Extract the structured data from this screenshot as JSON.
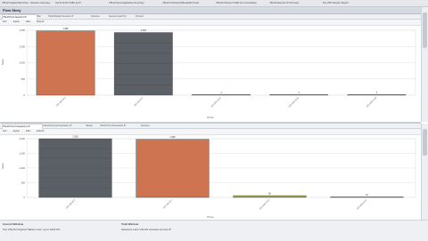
{
  "top_tabs": [
    {
      "label": "VSLAN Capital Reef Flow - Sessions Summary"
    },
    {
      "label": "Top-N VLAN Traffic by IP"
    },
    {
      "label": "VSLAN Host Application Summary"
    },
    {
      "label": "VSLAN Outbound Bandwidth Trend"
    },
    {
      "label": "VSLAN Inbound Traffic by Conversation"
    },
    {
      "label": "VSLAN Remote IP Summary"
    },
    {
      "label": "Top VPN Session Report"
    }
  ],
  "window": {
    "title": "Flow Story"
  },
  "upper_panel": {
    "tabs": [
      "VSLAN Host Sessions IP",
      "Bar",
      "Table/Stacked Sessions IP",
      "Sessions",
      "Sessions (last 5m)",
      "Protocol"
    ],
    "toolbar": [
      "Sort",
      "Export",
      "Filter",
      "Refresh"
    ],
    "x_title": "Proto",
    "y_title": "Sess"
  },
  "lower_panel": {
    "tabs": [
      "VSLAN Host Transactions IP",
      "VSLAN Remote Destination IP",
      "Tabular",
      "VSLAN Host Destination IP",
      "Sessions"
    ],
    "toolbar": [
      "Sort",
      "Export",
      "Filter",
      "Refresh"
    ],
    "x_title": "Proto",
    "y_title": "Sess"
  },
  "status": {
    "left_label": "Current Window",
    "left_text": "Top VSLAN Original Talkers  max: up to 1023 IPs",
    "right_label": "Total Window",
    "right_text": "Selected: Host VSLAN sessions across IP"
  },
  "colors": {
    "orange": "#cf7450",
    "gray": "#5b6066",
    "background": "#ffffff"
  },
  "chart_data": [
    {
      "type": "bar",
      "categories": [
        "192.168.10.5",
        "192.168.10.7",
        "192.168.10.12",
        "192.168.10.21",
        "192.168.10.33"
      ],
      "values": [
        1980,
        1930,
        3,
        4,
        3
      ],
      "value_labels": [
        "1,980",
        "1,930",
        "3",
        "4",
        "3"
      ],
      "bar_colors": [
        "#cf7450",
        "#5b6066",
        "#7a6f66",
        "#7a6f66",
        "#7a6f66"
      ],
      "yticks": [
        "0",
        "500",
        "1,000",
        "1,500",
        "2,000"
      ],
      "ylim": [
        0,
        2000
      ],
      "grid": true
    },
    {
      "type": "bar",
      "categories": [
        "192.168.10.5",
        "192.168.10.7",
        "192.168.10.12",
        "192.168.10.21"
      ],
      "values": [
        2000,
        1980,
        60,
        10
      ],
      "value_labels": [
        "2,000",
        "1,980",
        "60",
        "10"
      ],
      "bar_colors": [
        "#5b6066",
        "#cf7450",
        "#a5a145",
        "#5b6f8a"
      ],
      "yticks": [
        "0",
        "500",
        "1,000",
        "1,500",
        "2,000"
      ],
      "ylim": [
        0,
        2000
      ],
      "grid": true
    }
  ]
}
